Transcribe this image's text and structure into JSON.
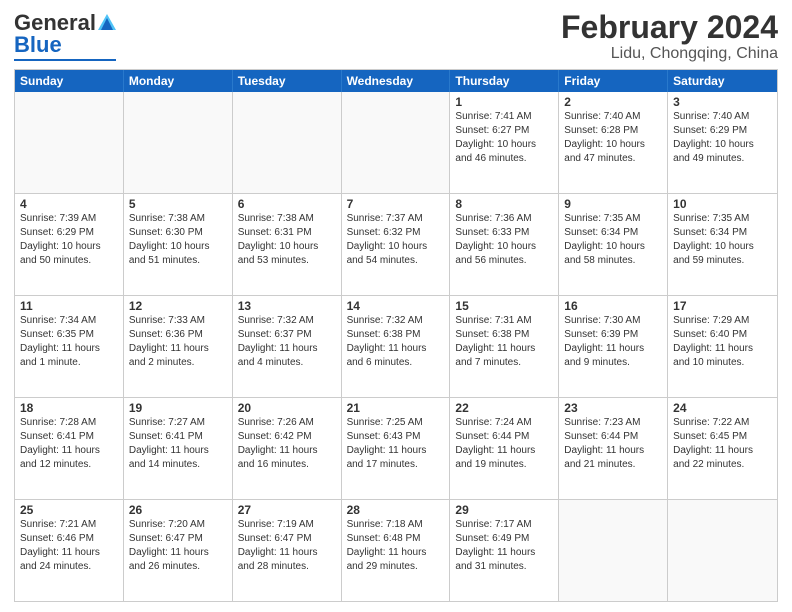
{
  "header": {
    "logo_general": "General",
    "logo_blue": "Blue",
    "month_year": "February 2024",
    "location": "Lidu, Chongqing, China"
  },
  "days_of_week": [
    "Sunday",
    "Monday",
    "Tuesday",
    "Wednesday",
    "Thursday",
    "Friday",
    "Saturday"
  ],
  "weeks": [
    [
      {
        "day": "",
        "info": ""
      },
      {
        "day": "",
        "info": ""
      },
      {
        "day": "",
        "info": ""
      },
      {
        "day": "",
        "info": ""
      },
      {
        "day": "1",
        "info": "Sunrise: 7:41 AM\nSunset: 6:27 PM\nDaylight: 10 hours\nand 46 minutes."
      },
      {
        "day": "2",
        "info": "Sunrise: 7:40 AM\nSunset: 6:28 PM\nDaylight: 10 hours\nand 47 minutes."
      },
      {
        "day": "3",
        "info": "Sunrise: 7:40 AM\nSunset: 6:29 PM\nDaylight: 10 hours\nand 49 minutes."
      }
    ],
    [
      {
        "day": "4",
        "info": "Sunrise: 7:39 AM\nSunset: 6:29 PM\nDaylight: 10 hours\nand 50 minutes."
      },
      {
        "day": "5",
        "info": "Sunrise: 7:38 AM\nSunset: 6:30 PM\nDaylight: 10 hours\nand 51 minutes."
      },
      {
        "day": "6",
        "info": "Sunrise: 7:38 AM\nSunset: 6:31 PM\nDaylight: 10 hours\nand 53 minutes."
      },
      {
        "day": "7",
        "info": "Sunrise: 7:37 AM\nSunset: 6:32 PM\nDaylight: 10 hours\nand 54 minutes."
      },
      {
        "day": "8",
        "info": "Sunrise: 7:36 AM\nSunset: 6:33 PM\nDaylight: 10 hours\nand 56 minutes."
      },
      {
        "day": "9",
        "info": "Sunrise: 7:35 AM\nSunset: 6:34 PM\nDaylight: 10 hours\nand 58 minutes."
      },
      {
        "day": "10",
        "info": "Sunrise: 7:35 AM\nSunset: 6:34 PM\nDaylight: 10 hours\nand 59 minutes."
      }
    ],
    [
      {
        "day": "11",
        "info": "Sunrise: 7:34 AM\nSunset: 6:35 PM\nDaylight: 11 hours\nand 1 minute."
      },
      {
        "day": "12",
        "info": "Sunrise: 7:33 AM\nSunset: 6:36 PM\nDaylight: 11 hours\nand 2 minutes."
      },
      {
        "day": "13",
        "info": "Sunrise: 7:32 AM\nSunset: 6:37 PM\nDaylight: 11 hours\nand 4 minutes."
      },
      {
        "day": "14",
        "info": "Sunrise: 7:32 AM\nSunset: 6:38 PM\nDaylight: 11 hours\nand 6 minutes."
      },
      {
        "day": "15",
        "info": "Sunrise: 7:31 AM\nSunset: 6:38 PM\nDaylight: 11 hours\nand 7 minutes."
      },
      {
        "day": "16",
        "info": "Sunrise: 7:30 AM\nSunset: 6:39 PM\nDaylight: 11 hours\nand 9 minutes."
      },
      {
        "day": "17",
        "info": "Sunrise: 7:29 AM\nSunset: 6:40 PM\nDaylight: 11 hours\nand 10 minutes."
      }
    ],
    [
      {
        "day": "18",
        "info": "Sunrise: 7:28 AM\nSunset: 6:41 PM\nDaylight: 11 hours\nand 12 minutes."
      },
      {
        "day": "19",
        "info": "Sunrise: 7:27 AM\nSunset: 6:41 PM\nDaylight: 11 hours\nand 14 minutes."
      },
      {
        "day": "20",
        "info": "Sunrise: 7:26 AM\nSunset: 6:42 PM\nDaylight: 11 hours\nand 16 minutes."
      },
      {
        "day": "21",
        "info": "Sunrise: 7:25 AM\nSunset: 6:43 PM\nDaylight: 11 hours\nand 17 minutes."
      },
      {
        "day": "22",
        "info": "Sunrise: 7:24 AM\nSunset: 6:44 PM\nDaylight: 11 hours\nand 19 minutes."
      },
      {
        "day": "23",
        "info": "Sunrise: 7:23 AM\nSunset: 6:44 PM\nDaylight: 11 hours\nand 21 minutes."
      },
      {
        "day": "24",
        "info": "Sunrise: 7:22 AM\nSunset: 6:45 PM\nDaylight: 11 hours\nand 22 minutes."
      }
    ],
    [
      {
        "day": "25",
        "info": "Sunrise: 7:21 AM\nSunset: 6:46 PM\nDaylight: 11 hours\nand 24 minutes."
      },
      {
        "day": "26",
        "info": "Sunrise: 7:20 AM\nSunset: 6:47 PM\nDaylight: 11 hours\nand 26 minutes."
      },
      {
        "day": "27",
        "info": "Sunrise: 7:19 AM\nSunset: 6:47 PM\nDaylight: 11 hours\nand 28 minutes."
      },
      {
        "day": "28",
        "info": "Sunrise: 7:18 AM\nSunset: 6:48 PM\nDaylight: 11 hours\nand 29 minutes."
      },
      {
        "day": "29",
        "info": "Sunrise: 7:17 AM\nSunset: 6:49 PM\nDaylight: 11 hours\nand 31 minutes."
      },
      {
        "day": "",
        "info": ""
      },
      {
        "day": "",
        "info": ""
      }
    ]
  ]
}
